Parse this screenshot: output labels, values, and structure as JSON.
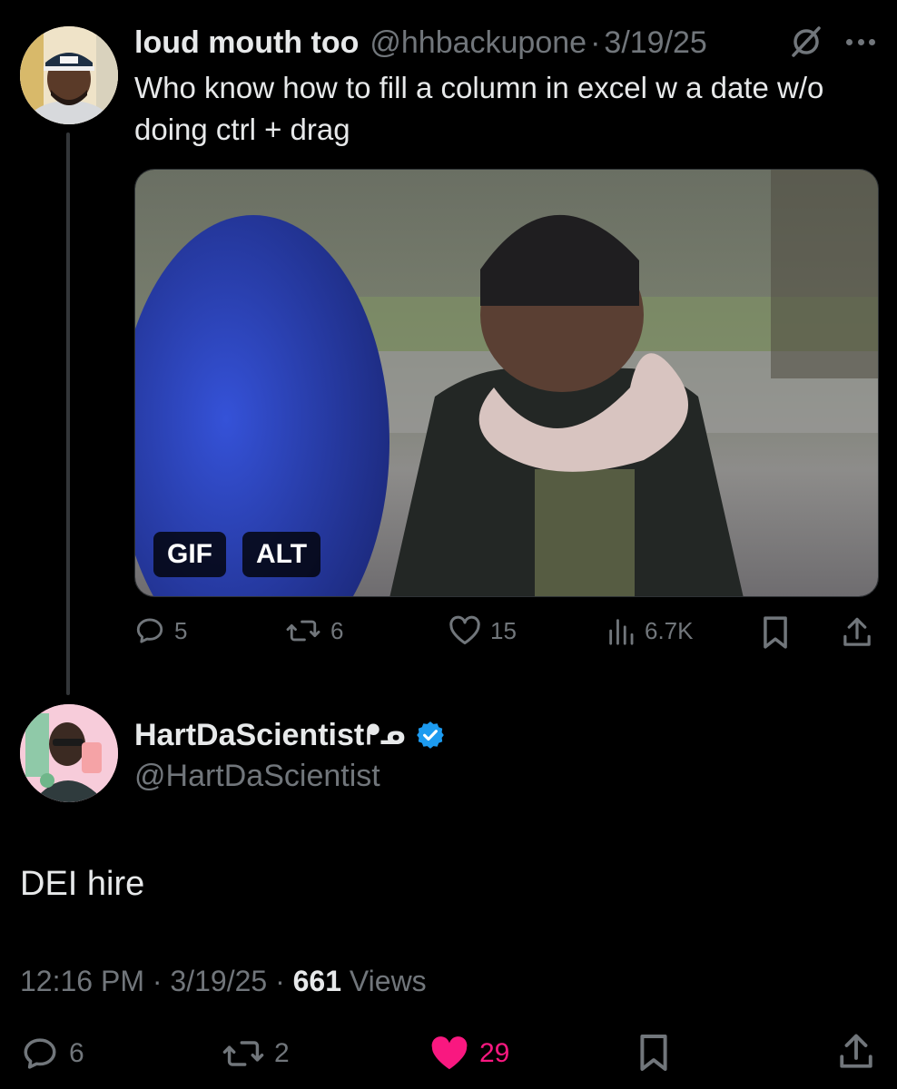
{
  "tweet": {
    "author_name": "loud mouth too",
    "author_handle": "@hhbackupone",
    "separator": "·",
    "date": "3/19/25",
    "text": "Who know how to fill a column in excel w a date w/o doing ctrl + drag",
    "media_badges": {
      "gif": "GIF",
      "alt": "ALT"
    },
    "actions": {
      "replies": "5",
      "reposts": "6",
      "likes": "15",
      "views": "6.7K"
    },
    "icons": [
      "mute-icon",
      "more-icon",
      "reply-icon",
      "repost-icon",
      "like-icon",
      "views-icon",
      "bookmark-icon",
      "share-icon"
    ]
  },
  "reply": {
    "author_name": "HartDaScientist",
    "name_emoji": "ᖰᓄ",
    "author_handle": "@HartDaScientist",
    "verified": true,
    "text": "DEI hire",
    "time": "12:16 PM",
    "separator": "·",
    "date": "3/19/25",
    "views_count": "661",
    "views_label": "Views",
    "actions": {
      "replies": "6",
      "reposts": "2",
      "likes": "29",
      "liked": true
    }
  },
  "colors": {
    "background": "#000000",
    "text_primary": "#e7e9ea",
    "text_secondary": "#71767b",
    "verified_blue": "#1d9bf0",
    "like_pink": "#f91880"
  }
}
